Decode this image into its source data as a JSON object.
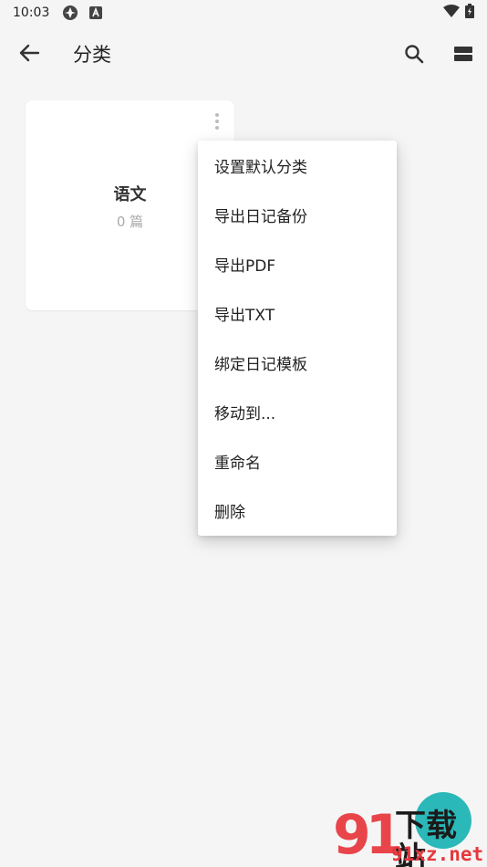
{
  "status_bar": {
    "time": "10:03"
  },
  "app_bar": {
    "title": "分类"
  },
  "category_card": {
    "name": "语文",
    "count": "0 篇"
  },
  "context_menu": {
    "items": [
      "设置默认分类",
      "导出日记备份",
      "导出PDF",
      "导出TXT",
      "绑定日记模板",
      "移动到...",
      "重命名",
      "删除"
    ]
  },
  "watermark": {
    "brand": "91",
    "title": "下载站",
    "url": "91xz.net"
  },
  "colors": {
    "background": "#f5f5f5",
    "fab": "#2bb8b9",
    "watermark_red": "#e7373c"
  }
}
